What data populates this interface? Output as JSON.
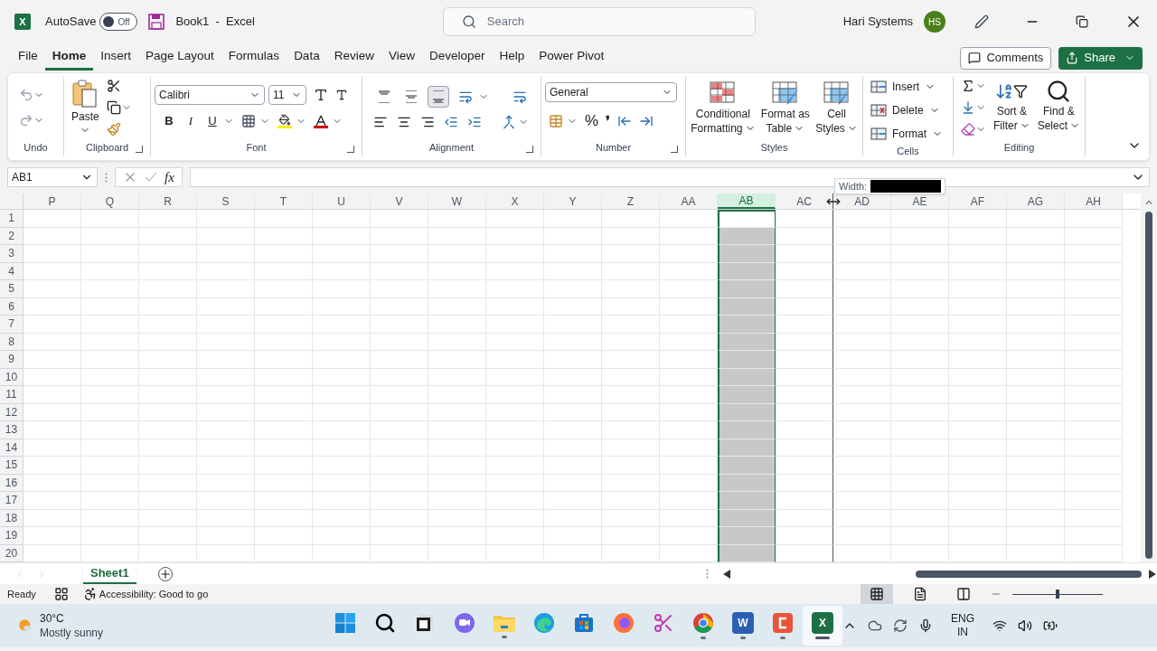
{
  "title_bar": {
    "app_letter": "X",
    "autosave_label": "AutoSave",
    "autosave_toggle": {
      "label": "Off",
      "on": false
    },
    "document_title": "Book1  -  Excel",
    "search_placeholder": "Search",
    "user_name": "Hari Systems",
    "avatar_initials": "HS"
  },
  "menu_tabs": [
    {
      "label": "File",
      "selected": false
    },
    {
      "label": "Home",
      "selected": true
    },
    {
      "label": "Insert",
      "selected": false
    },
    {
      "label": "Page Layout",
      "selected": false
    },
    {
      "label": "Formulas",
      "selected": false
    },
    {
      "label": "Data",
      "selected": false
    },
    {
      "label": "Review",
      "selected": false
    },
    {
      "label": "View",
      "selected": false
    },
    {
      "label": "Developer",
      "selected": false
    },
    {
      "label": "Help",
      "selected": false
    },
    {
      "label": "Power Pivot",
      "selected": false
    }
  ],
  "comments_button": "Comments",
  "share_button": "Share",
  "ribbon": {
    "undo": {
      "label": "Undo"
    },
    "clipboard": {
      "paste": "Paste",
      "label": "Clipboard"
    },
    "font": {
      "font_name": "Calibri",
      "font_size": "11",
      "bold": "B",
      "italic": "I",
      "underline": "U",
      "label": "Font"
    },
    "alignment": {
      "vertical": [
        {
          "kind": "top",
          "selected": false
        },
        {
          "kind": "middle",
          "selected": false
        },
        {
          "kind": "bottom",
          "selected": true
        }
      ],
      "label": "Alignment"
    },
    "number": {
      "format": "General",
      "percent": "%",
      "comma": "❜",
      "label": "Number"
    },
    "styles": {
      "buttons": [
        {
          "kind": "conditional",
          "lines": [
            "Conditional",
            "Formatting"
          ]
        },
        {
          "kind": "table",
          "lines": [
            "Format as",
            "Table"
          ]
        },
        {
          "kind": "cell",
          "lines": [
            "Cell",
            "Styles"
          ]
        }
      ],
      "label": "Styles"
    },
    "cells": {
      "buttons": [
        {
          "kind": "insert",
          "label": "Insert"
        },
        {
          "kind": "delete",
          "label": "Delete"
        },
        {
          "kind": "format",
          "label": "Format"
        }
      ],
      "label": "Cells"
    },
    "editing": {
      "buttons": [
        {
          "kind": "sort",
          "lines": [
            "Sort &",
            "Filter"
          ]
        },
        {
          "kind": "find",
          "lines": [
            "Find &",
            "Select"
          ]
        }
      ],
      "label": "Editing"
    }
  },
  "formula_bar": {
    "name_box": "AB1",
    "function_label": "fx"
  },
  "grid": {
    "columns": [
      {
        "label": "P",
        "selected": false,
        "resizing": false
      },
      {
        "label": "Q",
        "selected": false,
        "resizing": false
      },
      {
        "label": "R",
        "selected": false,
        "resizing": false
      },
      {
        "label": "S",
        "selected": false,
        "resizing": false
      },
      {
        "label": "T",
        "selected": false,
        "resizing": false
      },
      {
        "label": "U",
        "selected": false,
        "resizing": false
      },
      {
        "label": "V",
        "selected": false,
        "resizing": false
      },
      {
        "label": "W",
        "selected": false,
        "resizing": false
      },
      {
        "label": "X",
        "selected": false,
        "resizing": false
      },
      {
        "label": "Y",
        "selected": false,
        "resizing": false
      },
      {
        "label": "Z",
        "selected": false,
        "resizing": false
      },
      {
        "label": "AA",
        "selected": false,
        "resizing": false
      },
      {
        "label": "AB",
        "selected": true,
        "resizing": false
      },
      {
        "label": "AC",
        "selected": false,
        "resizing": true
      },
      {
        "label": "AD",
        "selected": false,
        "resizing": false
      },
      {
        "label": "AE",
        "selected": false,
        "resizing": false
      },
      {
        "label": "AF",
        "selected": false,
        "resizing": false
      },
      {
        "label": "AG",
        "selected": false,
        "resizing": false
      },
      {
        "label": "AH",
        "selected": false,
        "resizing": false
      }
    ],
    "rows": [
      "1",
      "2",
      "3",
      "4",
      "5",
      "6",
      "7",
      "8",
      "9",
      "10",
      "11",
      "12",
      "13",
      "14",
      "15",
      "16",
      "17",
      "18",
      "19",
      "20"
    ],
    "width_tooltip": "Width:"
  },
  "sheet_tabs": [
    {
      "label": "Sheet1",
      "selected": true
    }
  ],
  "status_bar": {
    "mode": "Ready",
    "accessibility": "Accessibility: Good to go",
    "views": [
      {
        "kind": "normal",
        "selected": true
      },
      {
        "kind": "page",
        "selected": false
      },
      {
        "kind": "break",
        "selected": false
      }
    ],
    "zoom": {
      "level": 0.5
    }
  },
  "taskbar": {
    "temperature": "30°C",
    "weather": "Mostly sunny",
    "apps": [
      {
        "kind": "start",
        "running": false,
        "selected": false
      },
      {
        "kind": "search",
        "running": false,
        "selected": false
      },
      {
        "kind": "taskview",
        "running": false,
        "selected": false
      },
      {
        "kind": "teams",
        "running": false,
        "selected": false
      },
      {
        "kind": "explorer",
        "running": true,
        "selected": false
      },
      {
        "kind": "edge",
        "running": false,
        "selected": false
      },
      {
        "kind": "store",
        "running": false,
        "selected": false
      },
      {
        "kind": "firefox",
        "running": false,
        "selected": false
      },
      {
        "kind": "snipping",
        "running": false,
        "selected": false
      },
      {
        "kind": "chrome",
        "running": true,
        "selected": false
      },
      {
        "kind": "word",
        "running": true,
        "selected": false,
        "letter": "W"
      },
      {
        "kind": "camtasia",
        "running": true,
        "selected": false
      },
      {
        "kind": "excel",
        "running": true,
        "selected": true,
        "letter": "X"
      }
    ],
    "language": [
      "ENG",
      "IN"
    ]
  }
}
